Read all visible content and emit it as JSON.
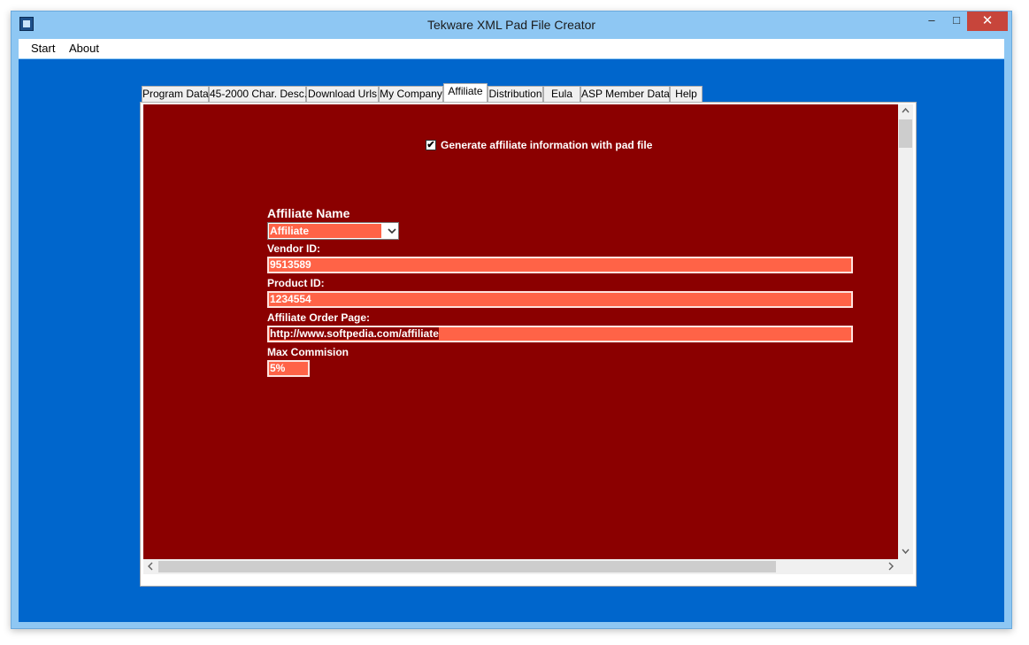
{
  "window": {
    "title": "Tekware XML Pad File Creator",
    "min_glyph": "–",
    "max_glyph": "□",
    "close_glyph": "✕"
  },
  "menu": {
    "items": [
      "Start",
      "About"
    ]
  },
  "tabs": [
    "Program Data",
    "45-2000 Char. Desc.",
    "Download Urls",
    "My Company",
    "Affiliate",
    "Distribution",
    "Eula",
    "ASP Member Data",
    "Help"
  ],
  "active_tab": "Affiliate",
  "affiliate": {
    "generate_checkbox": {
      "label": "Generate affiliate information with pad file",
      "checked": true,
      "glyph": "✔"
    },
    "affiliate_name_label": "Affiliate Name",
    "affiliate_name_value": "Affiliate",
    "vendor_id_label": "Vendor ID:",
    "vendor_id_value": "9513589",
    "product_id_label": "Product ID:",
    "product_id_value": "1234554",
    "order_page_label": "Affiliate Order Page:",
    "order_page_value": "http://www.softpedia.com/affiliate",
    "max_commission_label": "Max Commision",
    "max_commission_value": "5%"
  },
  "colors": {
    "panel_background": "#8b0000",
    "field_background": "#ff6347",
    "client_background": "#0066cc",
    "title_bar": "#8ec7f3"
  },
  "icons": {
    "dropdown": "chevron-down-icon",
    "scroll_up": "scroll-up-icon",
    "scroll_down": "scroll-down-icon",
    "scroll_left": "scroll-left-icon",
    "scroll_right": "scroll-right-icon"
  }
}
